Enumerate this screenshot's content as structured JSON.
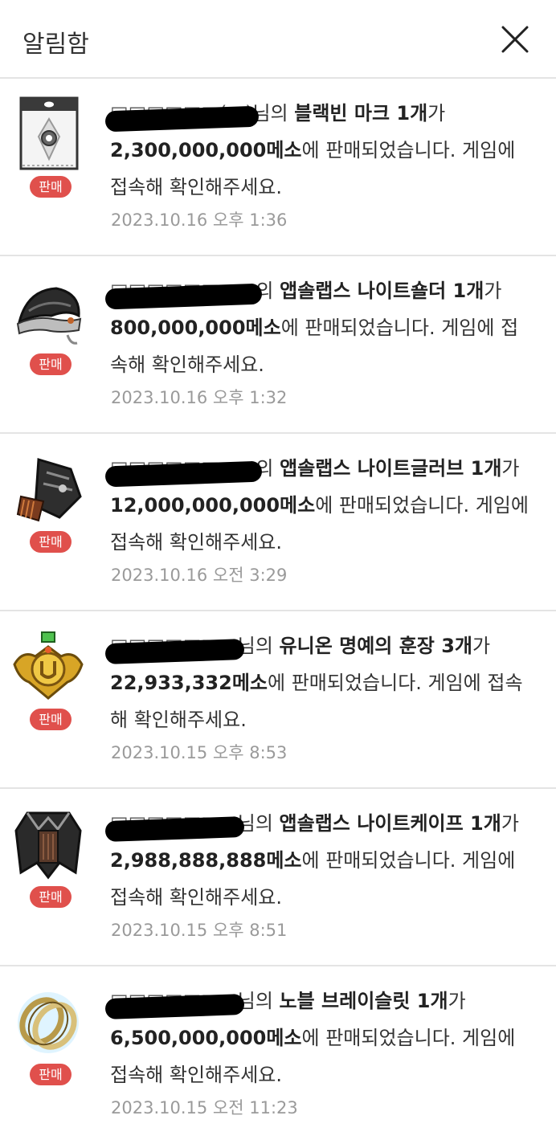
{
  "header": {
    "title": "알림함"
  },
  "notifications": [
    {
      "seller": "□□□□□□(□)",
      "p1": "님의 ",
      "item": "블랙빈 마크 1개",
      "p2": "가 ",
      "price": "2,300,000,000메소",
      "p3": "에 판매되었습니다. 게임에 접속해 확인해주세요.",
      "badge": "판매",
      "time": "2023.10.16 오후 1:36",
      "icon": "blackbean-mark-icon"
    },
    {
      "seller": "□□□□□□□□",
      "p1": "의 ",
      "item": "앱솔랩스 나이트숄더 1개",
      "p2": "가 ",
      "price": "800,000,000메소",
      "p3": "에 판매되었습니다. 게임에 접속해 확인해주세요.",
      "badge": "판매",
      "time": "2023.10.16 오후 1:32",
      "icon": "knight-shoulder-icon"
    },
    {
      "seller": "□□□□□□□□",
      "p1": "의 ",
      "item": "앱솔랩스 나이트글러브 1개",
      "p2": "가 ",
      "price": "12,000,000,000메소",
      "p3": "에 판매되었습니다. 게임에 접속해 확인해주세요.",
      "badge": "판매",
      "time": "2023.10.16 오전 3:29",
      "icon": "knight-glove-icon"
    },
    {
      "seller": "□□□□□□□",
      "p1": "님의 ",
      "item": "유니온 명예의 훈장 3개",
      "p2": "가 ",
      "price": "22,933,332메소",
      "p3": "에 판매되었습니다. 게임에 접속해 확인해주세요.",
      "badge": "판매",
      "time": "2023.10.15 오후 8:53",
      "icon": "union-medal-icon"
    },
    {
      "seller": "□□□□□□□",
      "p1": "님의 ",
      "item": "앱솔랩스 나이트케이프 1개",
      "p2": "가 ",
      "price": "2,988,888,888메소",
      "p3": "에 판매되었습니다. 게임에 접속해 확인해주세요.",
      "badge": "판매",
      "time": "2023.10.15 오후 8:51",
      "icon": "knight-cape-icon"
    },
    {
      "seller": "□□□□□□□",
      "p1": "님의 ",
      "item": "노블 브레이슬릿 1개",
      "p2": "가 ",
      "price": "6,500,000,000메소",
      "p3": "에 판매되었습니다. 게임에 접속해 확인해주세요.",
      "badge": "판매",
      "time": "2023.10.15 오전 11:23",
      "icon": "noble-bracelet-icon"
    }
  ]
}
